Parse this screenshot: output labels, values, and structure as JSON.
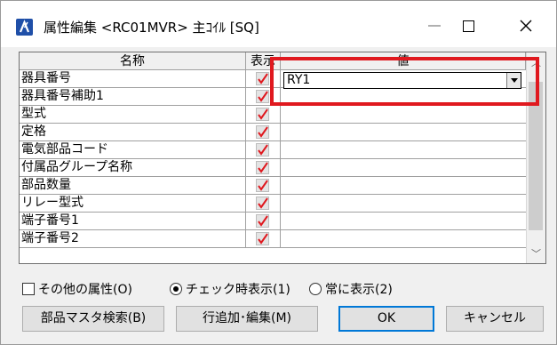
{
  "window": {
    "title": "属性編集 <RC01MVR> 主ｺｲﾙ [SQ]",
    "controls": {
      "minimize": "—",
      "maximize": "□",
      "close": "✕"
    }
  },
  "grid": {
    "headers": {
      "name": "名称",
      "display": "表示",
      "value": "値"
    },
    "rows": [
      {
        "name": "器具番号",
        "checked": true
      },
      {
        "name": "器具番号補助1",
        "checked": true
      },
      {
        "name": "型式",
        "checked": true
      },
      {
        "name": "定格",
        "checked": true
      },
      {
        "name": "電気部品コード",
        "checked": true
      },
      {
        "name": "付属品グループ名称",
        "checked": true
      },
      {
        "name": "部品数量",
        "checked": true
      },
      {
        "name": "リレー型式",
        "checked": true
      },
      {
        "name": "端子番号1",
        "checked": true
      },
      {
        "name": "端子番号2",
        "checked": true
      }
    ],
    "editing_value": "RY1",
    "highlight_color": "#e0191f"
  },
  "options": {
    "other_attributes_label": "その他の属性(O)",
    "other_attributes_checked": false,
    "radio_check_display_label": "チェック時表示(1)",
    "radio_check_display_selected": true,
    "radio_always_display_label": "常に表示(2)",
    "radio_always_display_selected": false
  },
  "buttons": {
    "parts_master_search": "部品マスタ検索(B)",
    "add_edit_row": "行追加･編集(M)",
    "ok": "OK",
    "cancel": "キャンセル"
  }
}
